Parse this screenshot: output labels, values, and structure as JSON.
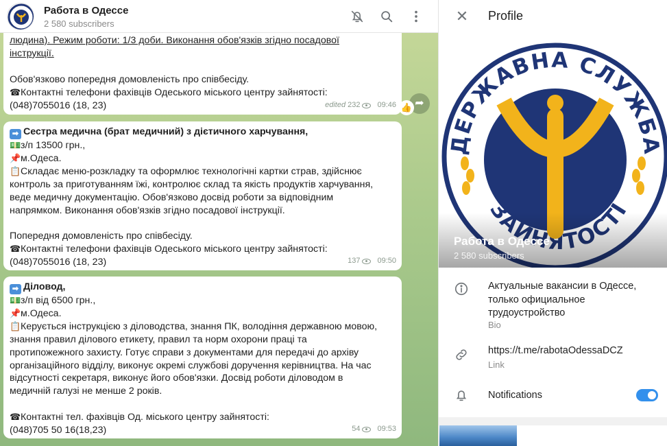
{
  "chat": {
    "title": "Работа в Одессе",
    "subscribers": "2 580 subscribers",
    "icons": [
      "mute-icon",
      "search-icon",
      "more-vert-icon"
    ],
    "messages": [
      {
        "lines": [
          "людина). Режим роботи: 1/3 доби. Виконання обов'язків згідно посадової",
          "інструкції.",
          "",
          "Обов'язково попередня домовленість про співбесіду.",
          "Контактні телефони фахівців Одеського міського центру зайнятості:",
          "(048)7055016 (18, 23)"
        ],
        "edited": "edited",
        "views": "232",
        "time": "09:46",
        "reaction": "👍"
      },
      {
        "title": "Сестра медична (брат медичний) з дієтичного харчування,",
        "lines": [
          "з/п 13500 грн.,",
          "м.Одеса.",
          "Складає меню-розкладку та оформлює технологічні картки страв, здійснює",
          "контроль за приготуванням їжі, контролює склад та якість продуктів харчування,",
          "веде медичну документацію. Обов'язково досвід роботи за відповідним",
          "напрямком. Виконання обов'язків згідно посадової інструкції.",
          "",
          "Попередня домовленість про співбесіду.",
          "Контактні телефони фахівців Одеського міського центру зайнятості:",
          "(048)7055016 (18, 23)"
        ],
        "views": "137",
        "time": "09:50"
      },
      {
        "title": "Діловод,",
        "lines": [
          "з/п від 6500 грн.,",
          "м.Одеса.",
          "Керується інструкцією з діловодства, знання ПК, володіння державною мовою,",
          "знання правил ділового етикету, правил та норм охорони праці та",
          "протипожежного захисту. Готує справи з документами для передачі до архіву",
          "організаційного відділу, виконує окремі службові доручення керівництва. На час",
          "відсутності секретаря, виконує його обов'язки. Досвід роботи діловодом в",
          "медичній галузі не менше 2 років.",
          "",
          "Контактні тел. фахівців Од. міського центру зайнятості:",
          "(048)705 50 16(18,23)"
        ],
        "views": "54",
        "time": "09:53"
      }
    ]
  },
  "profile": {
    "header_title": "Profile",
    "cover_name": "Работа в Одессе",
    "cover_subscribers": "2 580 subscribers",
    "logo_top_text": "ДЕРЖАВНА СЛУЖБА",
    "logo_bottom_text": "ЗАЙНЯТОСТІ",
    "bio_line1": "Актуальные вакансии в Одессе,",
    "bio_line2": "только официальное",
    "bio_line3": "трудоустройство",
    "bio_label": "Bio",
    "link": "https://t.me/rabotaOdessaDCZ",
    "link_label": "Link",
    "notifications_label": "Notifications",
    "notifications_on": true
  },
  "colors": {
    "accent": "#3390ec",
    "logo_blue": "#1f3576",
    "logo_gold": "#f2b31b"
  }
}
